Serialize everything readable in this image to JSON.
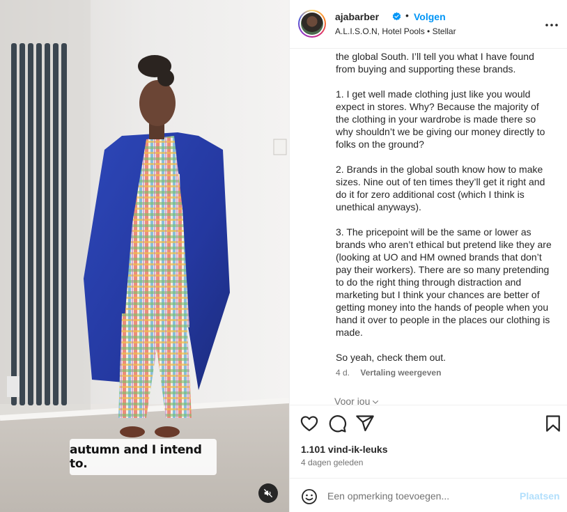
{
  "post": {
    "username": "ajabarber",
    "follow_label": "Volgen",
    "location": "A.L.I.S.O.N, Hotel Pools • Stellar",
    "verified_icon": "verified-badge-icon",
    "more_icon": "more-options-icon"
  },
  "video": {
    "subtitle_text": "autumn and I intend to.",
    "mute_icon": "speaker-muted-icon"
  },
  "caption": {
    "lines_a": "the global South. I’ll tell you what I have found from buying and supporting these brands.",
    "para1": "1. I get well made clothing just like you would expect in stores. Why? Because the majority of the clothing in your wardrobe is made there so why shouldn’t we be giving our money directly to folks on the ground?",
    "para2": "2. Brands in the global south know how to make sizes. Nine out of ten times they’ll get it right and do it for zero additional cost (which I think is unethical anyways).",
    "para3": "3. The pricepoint will be the same or lower as brands who aren’t ethical but pretend like they are (looking at UO and HM owned brands that don’t pay their workers). There are so many pretending to do the right thing through distraction and marketing but I think your chances are better of getting money into the hands of people when you hand it over to people in the places our clothing is made.",
    "para4": "So yeah, check them out.",
    "time": "4 d.",
    "translate_label": "Vertaling weergeven",
    "for_you_label": "Voor jou"
  },
  "actions": {
    "like_icon": "heart-icon",
    "comment_icon": "comment-icon",
    "share_icon": "share-icon",
    "save_icon": "bookmark-icon"
  },
  "stats": {
    "likes": "1.101 vind-ik-leuks",
    "posted": "4 dagen geleden"
  },
  "comment": {
    "placeholder": "Een opmerking toevoegen...",
    "post_label": "Plaatsen",
    "emoji_icon": "emoji-icon"
  },
  "colors": {
    "accent": "#0095f6",
    "accent_disabled": "#b2dffc",
    "text": "#262626",
    "secondary": "#737373"
  }
}
